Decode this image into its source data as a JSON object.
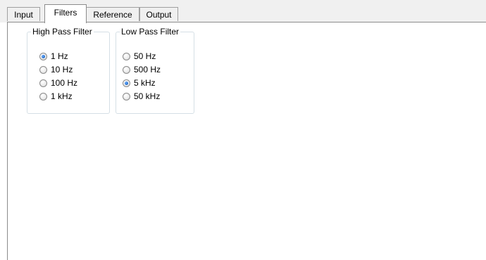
{
  "tabs": [
    {
      "label": "Input",
      "active": false
    },
    {
      "label": "Filters",
      "active": true
    },
    {
      "label": "Reference",
      "active": false
    },
    {
      "label": "Output",
      "active": false
    }
  ],
  "high_pass": {
    "title": "High Pass Filter",
    "options": [
      {
        "label": "1 Hz",
        "checked": true
      },
      {
        "label": "10 Hz",
        "checked": false
      },
      {
        "label": "100 Hz",
        "checked": false
      },
      {
        "label": "1 kHz",
        "checked": false
      }
    ]
  },
  "low_pass": {
    "title": "Low Pass Filter",
    "options": [
      {
        "label": "50 Hz",
        "checked": false
      },
      {
        "label": "500 Hz",
        "checked": false
      },
      {
        "label": "5 kHz",
        "checked": true
      },
      {
        "label": "50 kHz",
        "checked": false
      }
    ]
  }
}
